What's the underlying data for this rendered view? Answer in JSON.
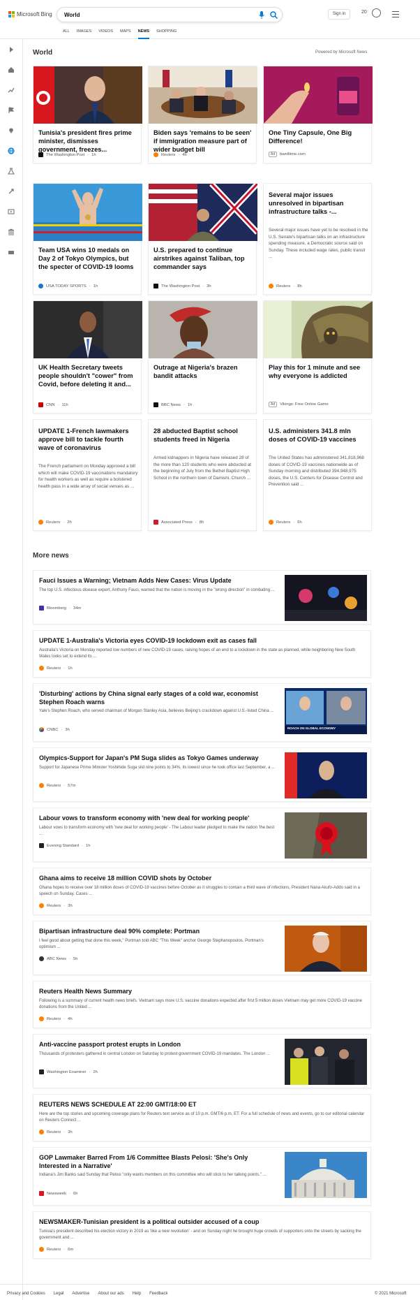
{
  "header": {
    "brand": "Microsoft Bing",
    "query": "World",
    "signin": "Sign in",
    "rewards": "20",
    "tabs": [
      {
        "label": "ALL"
      },
      {
        "label": "IMAGES"
      },
      {
        "label": "VIDEOS"
      },
      {
        "label": "MAPS"
      },
      {
        "label": "NEWS"
      },
      {
        "label": "SHOPPING"
      }
    ],
    "active_tab": "NEWS",
    "accent": "#0078d4"
  },
  "main": {
    "section_title": "World",
    "powered_by": "Powered by Microsoft News",
    "cards": [
      {
        "title": "Tunisia's president fires prime minister, dismisses government, freezes...",
        "source": "The Washington Post",
        "age": "1h"
      },
      {
        "title": "Biden says 'remains to be seen' if immigration measure part of wider budget bill",
        "source": "Reuters",
        "age": "4h"
      },
      {
        "title": "One Tiny Capsule, One Big Difference!",
        "ad": "Ad",
        "source": "bwelltime.com"
      },
      {
        "title": "Team USA wins 10 medals on Day 2 of Tokyo Olympics, but the specter of COVID-19 looms",
        "source": "USA TODAY SPORTS",
        "age": "1h"
      },
      {
        "title": "U.S. prepared to continue airstrikes against Taliban, top commander says",
        "source": "The Washington Post",
        "age": "3h"
      },
      {
        "title": "Several major issues unresolved in bipartisan infrastructure talks -...",
        "snippet": "Several major issues have yet to be resolved in the U.S. Senate's bipartisan talks on an infrastructure spending measure, a Democratic source said on Sunday. These included wage rates, public transit ...",
        "source": "Reuters",
        "age": "8h"
      },
      {
        "title": "UK Health Secretary tweets people shouldn't \"cower\" from Covid, before deleting it and...",
        "source": "CNN",
        "age": "11h"
      },
      {
        "title": "Outrage at Nigeria's brazen bandit attacks",
        "source": "BBC News",
        "age": "1h"
      },
      {
        "title": "Play this for 1 minute and see why everyone is addicted",
        "ad": "Ad",
        "source": "Vikings: Free Online Game"
      },
      {
        "title": "UPDATE 1-French lawmakers approve bill to tackle fourth wave of coronavirus",
        "snippet": "The French parliament on Monday approved a bill which will make COVID-19 vaccinations mandatory for health workers as well as require a bolstered health pass in a wide array of social venues as ...",
        "source": "Reuters",
        "age": "2h"
      },
      {
        "title": "28 abducted Baptist school students freed in Nigeria",
        "snippet": "Armed kidnappers in Nigeria have released 28 of the more than 120 students who were abducted at the beginning of July from the Bethel Baptist High School in the northern town of Damishi. Church ...",
        "source": "Associated Press",
        "age": "8h"
      },
      {
        "title": "U.S. administers 341.8 mln doses of COVID-19 vaccines",
        "snippet": "The United States has administered 341,818,968 doses of COVID-19 vaccines nationwide as of Sunday morning and distributed 394,948,975 doses, the U.S. Centers for Disease Control and Prevention said ...",
        "source": "Reuters",
        "age": "6h"
      }
    ]
  },
  "more_news": {
    "title": "More news",
    "items": [
      {
        "title": "Fauci Issues a Warning; Vietnam Adds New Cases: Virus Update",
        "snippet": "The top U.S. infectious disease expert, Anthony Fauci, warned that the nation is moving in the \"wrong direction\" in combating ...",
        "source": "Bloomberg",
        "age": "34m"
      },
      {
        "title": "UPDATE 1-Australia's Victoria eyes COVID-19 lockdown exit as cases fall",
        "snippet": "Australia's Victoria on Monday reported low numbers of new COVID-19 cases, raising hopes of an end to a lockdown in the state as planned, while neighboring New South Wales looks set to extend its ...",
        "source": "Reuters",
        "age": "1h"
      },
      {
        "title": "'Disturbing' actions by China signal early stages of a cold war, economist Stephen Roach warns",
        "snippet": "Yale's Stephen Roach, who served chairman of Morgan Stanley Asia, believes Beijing's crackdown against U.S.-listed China ...",
        "source": "CNBC",
        "age": "3h",
        "img_caption": "ROACH ON GLOBAL ECONOMY"
      },
      {
        "title": "Olympics-Support for Japan's PM Suga slides as Tokyo Games underway",
        "snippet": "Support for Japanese Prime Minister Yoshihide Suga slid nine points to 34%, its lowest since he took office last September, a ...",
        "source": "Reuters",
        "age": "57m"
      },
      {
        "title": "Labour vows to transform economy with 'new deal for working people'",
        "snippet": "Labour vows to transform economy with 'new deal for working people' - The Labour leader pledged to make the nation 'the best ...",
        "source": "Evening Standard",
        "age": "1h"
      },
      {
        "title": "Ghana aims to receive 18 million COVID shots by October",
        "snippet": "Ghana hopes to receive over 18 million doses of COVID-19 vaccines before October as it struggles to contain a third wave of infections, President Nana Akufo-Addo said in a speech on Sunday. Cases ...",
        "source": "Reuters",
        "age": "3h"
      },
      {
        "title": "Bipartisan infrastructure deal 90% complete: Portman",
        "snippet": "I feel good about getting that done this week,\" Portman told ABC \"This Week\" anchor George Stephanopoulos. Portman's optimism ...",
        "source": "ABC News",
        "age": "5h"
      },
      {
        "title": "Reuters Health News Summary",
        "snippet": "Following is a summary of current health news briefs. Vietnam says more U.S. vaccine donations expected after first 5 million doses Vietnam may get more COVID-19 vaccine donations from the United ...",
        "source": "Reuters",
        "age": "4h"
      },
      {
        "title": "Anti-vaccine passport protest erupts in London",
        "snippet": "Thousands of protesters gathered in central London on Saturday to protest government COVID-19 mandates. The London ...",
        "source": "Washington Examiner",
        "age": "2h"
      },
      {
        "title": "REUTERS NEWS SCHEDULE AT 22:00 GMT/18:00 ET",
        "snippet": "Here are the top stories and upcoming coverage plans for Reuters text service as of 10 p.m. GMT/6 p.m. ET. For a full schedule of news and events, go to our editorial calendar on Reuters Connect ...",
        "source": "Reuters",
        "age": "3h"
      },
      {
        "title": "GOP Lawmaker Barred From 1/6 Committee Blasts Pelosi: 'She's Only Interested in a Narrative'",
        "snippet": "Indiana's Jim Banks said Sunday that Pelosi \"only wants members on this committee who will stick to her talking points.\" ...",
        "source": "Newsweek",
        "age": "6h"
      },
      {
        "title": "NEWSMAKER-Tunisian president is a political outsider accused of a coup",
        "snippet": "Tunisia's president described his election victory in 2019 as 'like a new revolution' - and on Sunday night he brought huge crowds of supporters onto the streets by sacking the government and ...",
        "source": "Reuters",
        "age": "6m"
      }
    ]
  },
  "footer": {
    "links": [
      "Privacy and Cookies",
      "Legal",
      "Advertise",
      "About our ads",
      "Help",
      "Feedback"
    ],
    "copyright": "© 2021 Microsoft"
  }
}
